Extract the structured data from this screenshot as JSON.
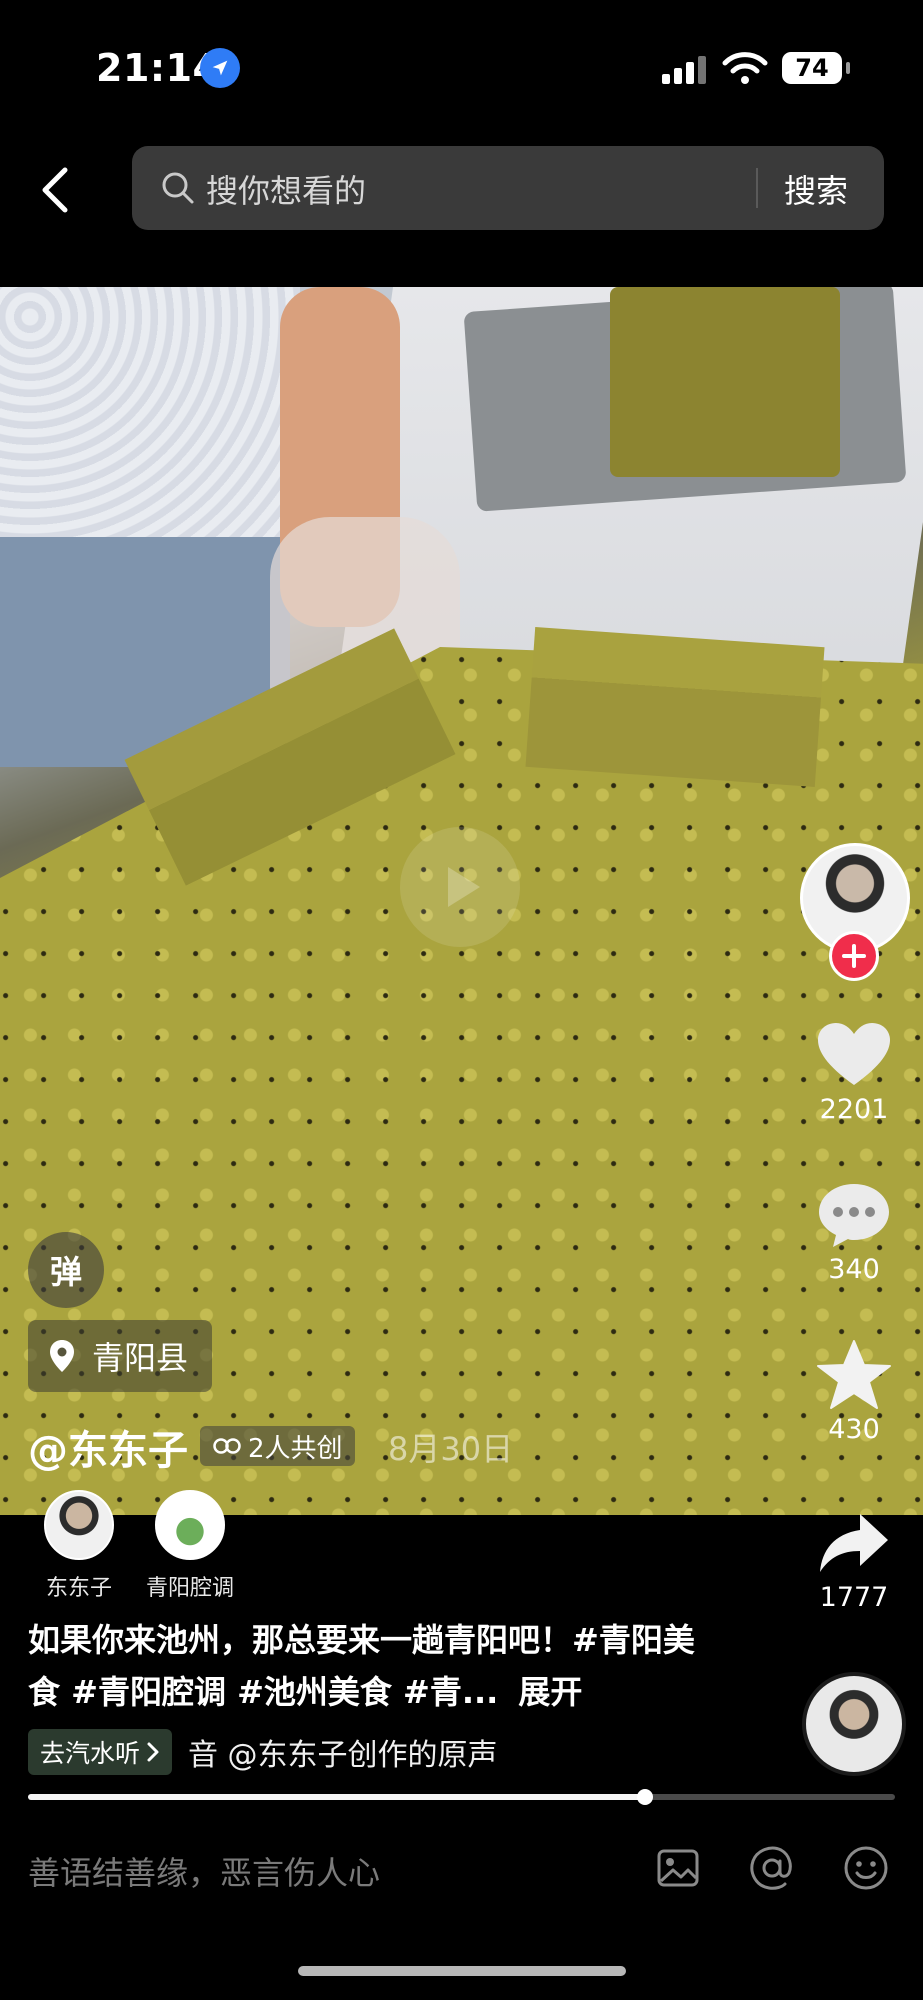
{
  "status_bar": {
    "time": "21:14",
    "battery": "74",
    "icons": [
      "location-arrow-icon",
      "cellular-signal-icon",
      "wifi-icon",
      "battery-icon"
    ]
  },
  "search": {
    "placeholder": "搜你想看的",
    "button": "搜索"
  },
  "video": {
    "progress": 0.712
  },
  "actions": {
    "likes": "2201",
    "comments": "340",
    "favorites": "430",
    "shares": "1777"
  },
  "overlay": {
    "danmu": "弹",
    "location": "青阳县",
    "author": "@东东子",
    "cocreate": "2人共创",
    "date": "8月30日"
  },
  "creators": [
    {
      "name": "东东子"
    },
    {
      "name": "青阳腔调"
    }
  ],
  "description": {
    "text": "如果你来池州，那总要来一趟青阳吧！#青阳美食 #青阳腔调 #池州美食 #青...",
    "expand": "展开"
  },
  "music": {
    "button": "去汽水听",
    "text": "⾳  @东东子创作的原声"
  },
  "comment_bar": {
    "placeholder": "善语结善缘，恶言伤人心"
  },
  "colors": {
    "accent_red": "#f02d4b",
    "search_bg": "#3a3a3a",
    "location_blue": "#2f7cf6"
  }
}
